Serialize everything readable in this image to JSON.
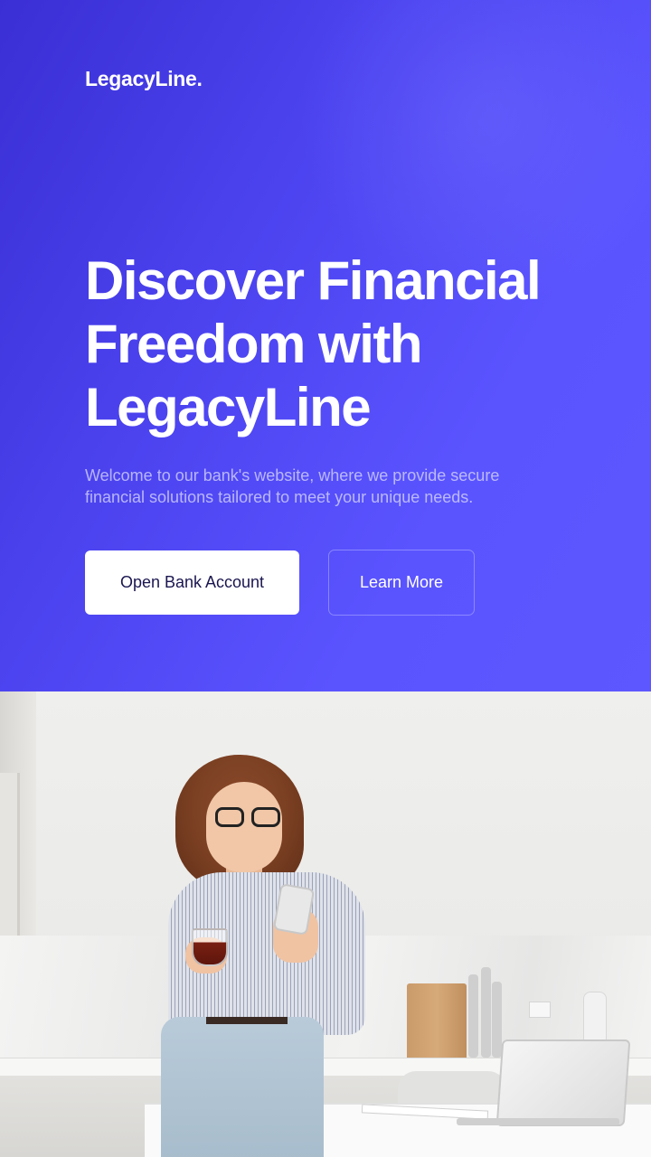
{
  "brand": {
    "logo": "LegacyLine."
  },
  "hero": {
    "headline": "Discover Financial Freedom with LegacyLine",
    "subtext": "Welcome to our bank's website, where we provide secure financial solutions tailored to meet your unique needs.",
    "primary_button": "Open Bank Account",
    "secondary_button": "Learn More"
  },
  "colors": {
    "hero_gradient_start": "#3a2fd4",
    "hero_gradient_end": "#5d57ff",
    "primary_button_bg": "#ffffff",
    "primary_button_text": "#1a1650"
  }
}
